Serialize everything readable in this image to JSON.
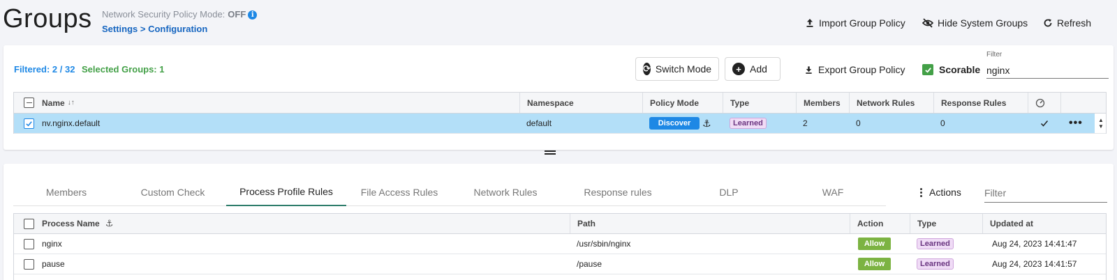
{
  "header": {
    "title": "Groups",
    "mode_label": "Network Security Policy Mode:",
    "mode_value": "OFF",
    "settings_link": "Settings > Configuration",
    "actions": {
      "import": "Import Group Policy",
      "hide_system": "Hide System Groups",
      "refresh": "Refresh"
    }
  },
  "toolbar": {
    "filtered": "Filtered: 2 / 32",
    "selected": "Selected Groups:  1",
    "switch_mode": "Switch Mode",
    "add": "Add",
    "export": "Export Group Policy",
    "scorable": "Scorable",
    "filter_label": "Filter",
    "filter_value": "nginx"
  },
  "groups_table": {
    "columns": {
      "name": "Name",
      "namespace": "Namespace",
      "policy_mode": "Policy Mode",
      "type": "Type",
      "members": "Members",
      "network_rules": "Network Rules",
      "response_rules": "Response Rules"
    },
    "rows": [
      {
        "name": "nv.nginx.default",
        "namespace": "default",
        "policy_mode": "Discover",
        "type": "Learned",
        "members": "2",
        "network_rules": "0",
        "response_rules": "0"
      }
    ]
  },
  "tabs": [
    {
      "label": "Members"
    },
    {
      "label": "Custom Check"
    },
    {
      "label": "Process Profile Rules"
    },
    {
      "label": "File Access Rules"
    },
    {
      "label": "Network Rules"
    },
    {
      "label": "Response rules"
    },
    {
      "label": "DLP"
    },
    {
      "label": "WAF"
    }
  ],
  "active_tab": "Process Profile Rules",
  "bottom_toolbar": {
    "actions": "Actions",
    "filter_placeholder": "Filter"
  },
  "process_table": {
    "columns": {
      "process_name": "Process Name",
      "path": "Path",
      "action": "Action",
      "type": "Type",
      "updated_at": "Updated at"
    },
    "rows": [
      {
        "process_name": "nginx",
        "path": "/usr/sbin/nginx",
        "action": "Allow",
        "type": "Learned",
        "updated_at": "Aug 24, 2023 14:41:47"
      },
      {
        "process_name": "pause",
        "path": "/pause",
        "action": "Allow",
        "type": "Learned",
        "updated_at": "Aug 24, 2023 14:41:57"
      }
    ]
  },
  "colors": {
    "accent_blue": "#1e88e5",
    "success_green": "#43a047",
    "allow_green": "#7cb342",
    "selected_row": "#b3dff8",
    "learned_badge": "#f0dcf6"
  }
}
